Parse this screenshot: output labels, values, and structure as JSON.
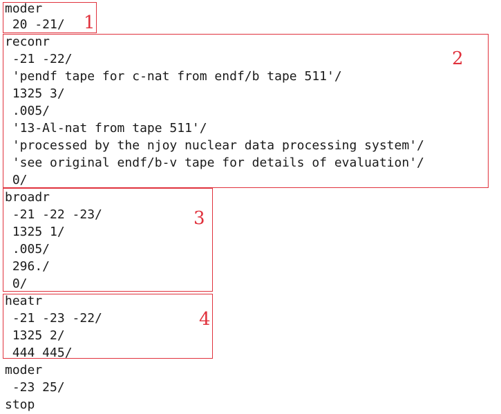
{
  "lines": [
    "moder",
    " 20 -21/",
    "reconr",
    " -21 -22/",
    " 'pendf tape for c-nat from endf/b tape 511'/",
    " 1325 3/",
    " .005/",
    " '13-Al-nat from tape 511'/",
    " 'processed by the njoy nuclear data processing system'/",
    " 'see original endf/b-v tape for details of evaluation'/",
    " 0/",
    "broadr",
    " -21 -22 -23/",
    " 1325 1/",
    " .005/",
    " 296./",
    " 0/",
    "heatr",
    " -21 -23 -22/",
    " 1325 2/",
    " 444 445/",
    "moder",
    " -23 25/",
    "stop"
  ],
  "annotations": [
    "1",
    "2",
    "3",
    "4"
  ],
  "colors": {
    "annotation": "#e0313c",
    "text": "#1a1a1a"
  }
}
